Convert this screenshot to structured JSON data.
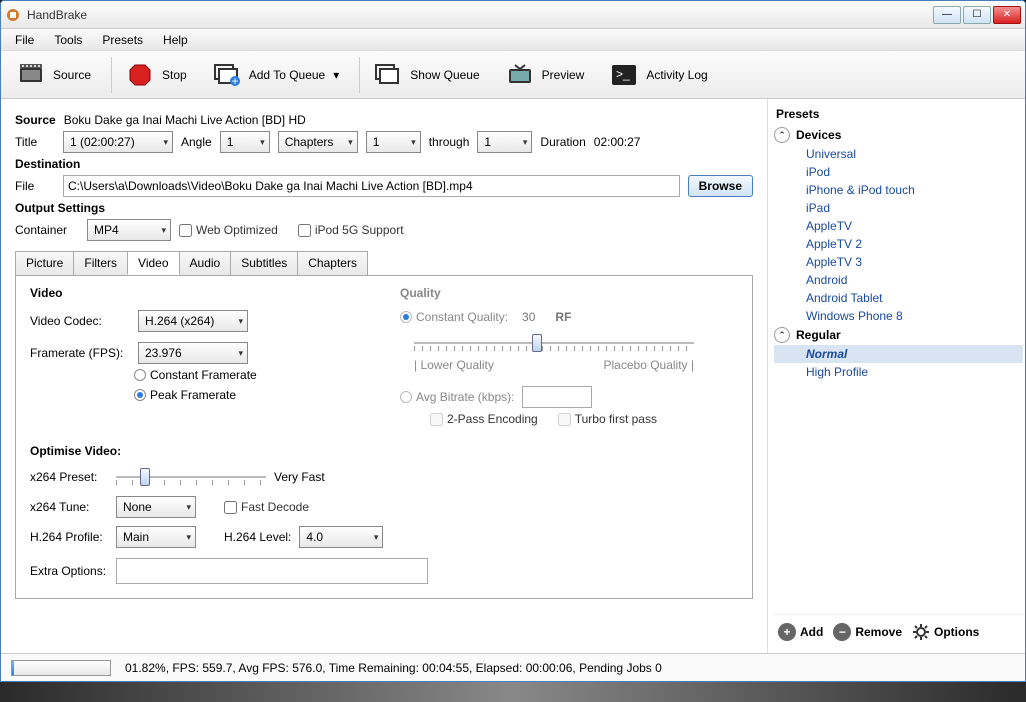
{
  "window": {
    "title": "HandBrake"
  },
  "menu": [
    "File",
    "Tools",
    "Presets",
    "Help"
  ],
  "toolbar": {
    "source": "Source",
    "stop": "Stop",
    "add_queue": "Add To Queue",
    "show_queue": "Show Queue",
    "preview": "Preview",
    "activity": "Activity Log"
  },
  "source": {
    "label": "Source",
    "value": "Boku Dake ga Inai Machi Live Action [BD] HD",
    "title_lbl": "Title",
    "title_val": "1 (02:00:27)",
    "angle_lbl": "Angle",
    "angle_val": "1",
    "chapters_val": "Chapters",
    "from_val": "1",
    "through_lbl": "through",
    "to_val": "1",
    "duration_lbl": "Duration",
    "duration_val": "02:00:27"
  },
  "destination": {
    "label": "Destination",
    "file_lbl": "File",
    "file_val": "C:\\Users\\a\\Downloads\\Video\\Boku Dake ga Inai Machi Live Action [BD].mp4",
    "browse": "Browse"
  },
  "output": {
    "label": "Output Settings",
    "container_lbl": "Container",
    "container_val": "MP4",
    "web_opt": "Web Optimized",
    "ipod": "iPod 5G Support"
  },
  "tabs": [
    "Picture",
    "Filters",
    "Video",
    "Audio",
    "Subtitles",
    "Chapters"
  ],
  "video_tab": {
    "video_hdr": "Video",
    "codec_lbl": "Video Codec:",
    "codec_val": "H.264 (x264)",
    "fps_lbl": "Framerate (FPS):",
    "fps_val": "23.976",
    "cfr": "Constant Framerate",
    "pfr": "Peak Framerate",
    "quality_hdr": "Quality",
    "cq_lbl": "Constant Quality:",
    "cq_val": "30",
    "rf_lbl": "RF",
    "lower_q": "| Lower Quality",
    "placebo_q": "Placebo Quality |",
    "avg_lbl": "Avg Bitrate (kbps):",
    "twopass": "2-Pass Encoding",
    "turbo": "Turbo first pass",
    "opt_hdr": "Optimise Video:",
    "preset_lbl": "x264 Preset:",
    "preset_val": "Very Fast",
    "tune_lbl": "x264 Tune:",
    "tune_val": "None",
    "fast_decode": "Fast Decode",
    "profile_lbl": "H.264 Profile:",
    "profile_val": "Main",
    "level_lbl": "H.264 Level:",
    "level_val": "4.0",
    "extra_lbl": "Extra Options:"
  },
  "presets": {
    "header": "Presets",
    "devices": "Devices",
    "device_items": [
      "Universal",
      "iPod",
      "iPhone & iPod touch",
      "iPad",
      "AppleTV",
      "AppleTV 2",
      "AppleTV 3",
      "Android",
      "Android Tablet",
      "Windows Phone 8"
    ],
    "regular": "Regular",
    "regular_items": [
      "Normal",
      "High Profile"
    ],
    "add": "Add",
    "remove": "Remove",
    "options": "Options"
  },
  "status": "01.82%,  FPS: 559.7,  Avg FPS: 576.0,  Time Remaining: 00:04:55,  Elapsed: 00:00:06,  Pending Jobs 0"
}
